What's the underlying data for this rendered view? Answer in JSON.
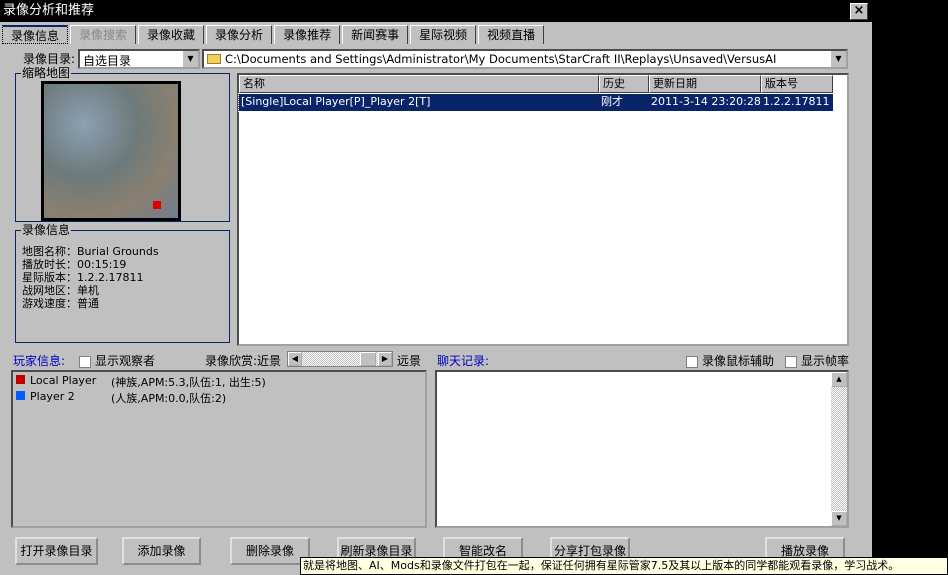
{
  "window": {
    "title": "录像分析和推荐",
    "close": "×"
  },
  "tabs": [
    {
      "label": "录像信息",
      "state": "active"
    },
    {
      "label": "录像搜索",
      "state": "disabled"
    },
    {
      "label": "录像收藏"
    },
    {
      "label": "录像分析"
    },
    {
      "label": "录像推荐"
    },
    {
      "label": "新闻赛事"
    },
    {
      "label": "星际视频"
    },
    {
      "label": "视频直播"
    }
  ],
  "dir": {
    "label": "录像目录:",
    "select": "自选目录",
    "path": "C:\\Documents and Settings\\Administrator\\My Documents\\StarCraft II\\Replays\\Unsaved\\VersusAI"
  },
  "thumbnail": {
    "label": "缩略地图"
  },
  "info": {
    "label": "录像信息",
    "rows": [
      {
        "k": "地图名称：",
        "v": "Burial Grounds"
      },
      {
        "k": "播放时长：",
        "v": "00:15:19"
      },
      {
        "k": "星际版本：",
        "v": "1.2.2.17811"
      },
      {
        "k": "战网地区：",
        "v": "单机"
      },
      {
        "k": "游戏速度：",
        "v": "普通"
      }
    ]
  },
  "list": {
    "headers": [
      "名称",
      "历史",
      "更新日期",
      "版本号"
    ],
    "rows": [
      {
        "name": "[Single]Local Player[P]_Player 2[T]",
        "history": "刚才",
        "date": "2011-3-14 23:20:28",
        "version": "1.2.2.17811"
      }
    ]
  },
  "players": {
    "label": "玩家信息:",
    "show_observers": "显示观察者",
    "view_label": "录像欣赏:近景",
    "far": "远景",
    "slider_value": 0.85,
    "items": [
      {
        "name": "Local Player",
        "detail": "(神族,APM:5.3,队伍:1, 出生:5)",
        "color": "#c00000"
      },
      {
        "name": "Player 2",
        "detail": "(人族,APM:0.0,队伍:2)",
        "color": "#0060ff"
      }
    ]
  },
  "chat": {
    "label": "聊天记录:",
    "mouse_assist": "录像鼠标辅助",
    "show_fps": "显示帧率"
  },
  "buttons": [
    "打开录像目录",
    "添加录像",
    "删除录像",
    "刷新录像目录",
    "智能改名",
    "分享打包录像",
    "播放录像"
  ],
  "tooltip": "就是将地图、AI、Mods和录像文件打包在一起，保证任何拥有星际管家7.5及其以上版本的同学都能观看录像，学习战术。"
}
